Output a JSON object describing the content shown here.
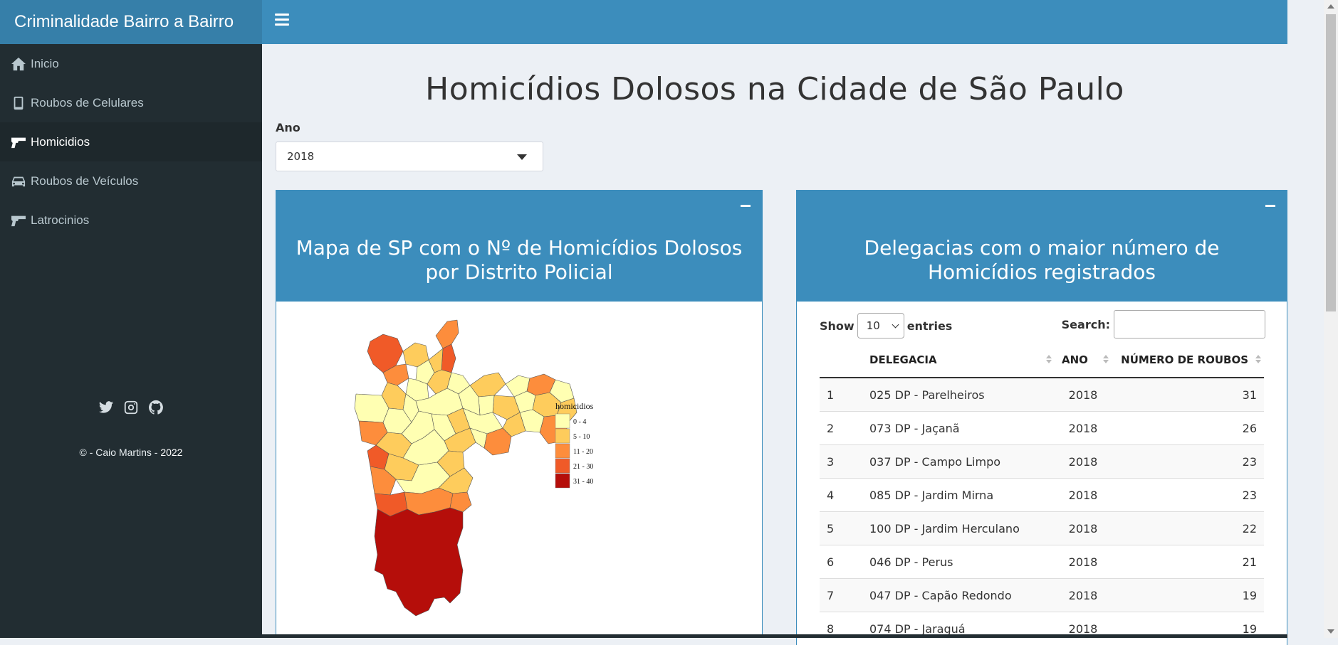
{
  "header": {
    "app_title": "Criminalidade Bairro a Bairro",
    "colors": {
      "header": "#3c8dbc",
      "logo": "#367fa9",
      "sidebar": "#222d32"
    }
  },
  "sidebar": {
    "items": [
      {
        "label": "Inicio",
        "icon": "home-icon"
      },
      {
        "label": "Roubos de Celulares",
        "icon": "mobile-phone-icon"
      },
      {
        "label": "Homicidios",
        "icon": "gun-icon",
        "active": true
      },
      {
        "label": "Roubos de Veículos",
        "icon": "car-icon"
      },
      {
        "label": "Latrocinios",
        "icon": "gun-icon"
      }
    ],
    "social": [
      "twitter-icon",
      "instagram-icon",
      "github-icon"
    ],
    "credit_prefix": "© - Caio Martins - ",
    "credit_year": "2022"
  },
  "main": {
    "page_title": "Homicídios Dolosos na Cidade de São Paulo",
    "year_filter": {
      "label": "Ano",
      "value": "2018"
    },
    "map_box": {
      "title": "Mapa de SP com o Nº de Homicídios Dolosos por Distrito Policial",
      "legend": {
        "title": "homicidios",
        "bins": [
          {
            "label": "0 - 4",
            "color": "#ffffb2"
          },
          {
            "label": "5 - 10",
            "color": "#fecc5c"
          },
          {
            "label": "11 - 20",
            "color": "#fd8d3c"
          },
          {
            "label": "21 - 30",
            "color": "#f03b20"
          },
          {
            "label": "31 - 40",
            "color": "#bd0026"
          }
        ]
      }
    },
    "table_box": {
      "title": "Delegacias com o maior número de Homicídios registrados",
      "show_label": "Show",
      "entries_value": "10",
      "entries_label": "entries",
      "search_label": "Search:",
      "columns": [
        "",
        "DELEGACIA",
        "ANO",
        "NÚMERO DE ROUBOS"
      ],
      "rows": [
        [
          "1",
          "025 DP - Parelheiros",
          "2018",
          "31"
        ],
        [
          "2",
          "073 DP - Jaçanã",
          "2018",
          "26"
        ],
        [
          "3",
          "037 DP - Campo Limpo",
          "2018",
          "23"
        ],
        [
          "4",
          "085 DP - Jardim Mirna",
          "2018",
          "23"
        ],
        [
          "5",
          "100 DP - Jardim Herculano",
          "2018",
          "22"
        ],
        [
          "6",
          "046 DP - Perus",
          "2018",
          "21"
        ],
        [
          "7",
          "047 DP - Capão Redondo",
          "2018",
          "19"
        ],
        [
          "8",
          "074 DP - Jaraguá",
          "2018",
          "19"
        ]
      ]
    }
  }
}
